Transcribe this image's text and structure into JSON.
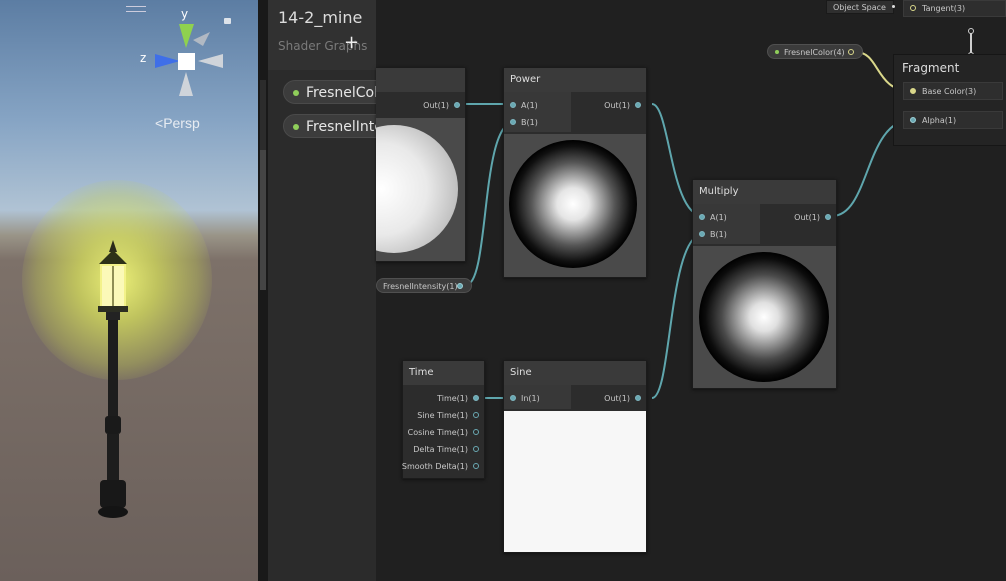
{
  "scene": {
    "gizmo": {
      "y_label": "y",
      "z_label": "z"
    },
    "persp_label": "Persp"
  },
  "blackboard": {
    "title": "14-2_mine",
    "subtitle": "Shader Graphs",
    "properties": [
      {
        "label": "FresnelColor"
      },
      {
        "label": "FresnelIntensity"
      }
    ]
  },
  "nodes": {
    "fresnel": {
      "out_label": "Out(1)"
    },
    "power": {
      "title": "Power",
      "in_a": "A(1)",
      "in_b": "B(1)",
      "out": "Out(1)"
    },
    "multiply": {
      "title": "Multiply",
      "in_a": "A(1)",
      "in_b": "B(1)",
      "out": "Out(1)"
    },
    "time": {
      "title": "Time",
      "ports": [
        "Time(1)",
        "Sine Time(1)",
        "Cosine Time(1)",
        "Delta Time(1)",
        "Smooth Delta(1)"
      ]
    },
    "sine": {
      "title": "Sine",
      "in": "In(1)",
      "out": "Out(1)"
    },
    "fresnel_intensity_prop": {
      "label": "FresnelIntensity(1)"
    },
    "fresnel_color_prop": {
      "label": "FresnelColor(4)"
    }
  },
  "vertex": {
    "object_space": "Object Space",
    "tangent": "Tangent(3)"
  },
  "fragment": {
    "title": "Fragment",
    "base_color": "Base Color(3)",
    "alpha": "Alpha(1)"
  },
  "colors": {
    "wire": "#5fa6ad",
    "color_port": "#d9d78a",
    "property_dot": "#8fce5a"
  }
}
